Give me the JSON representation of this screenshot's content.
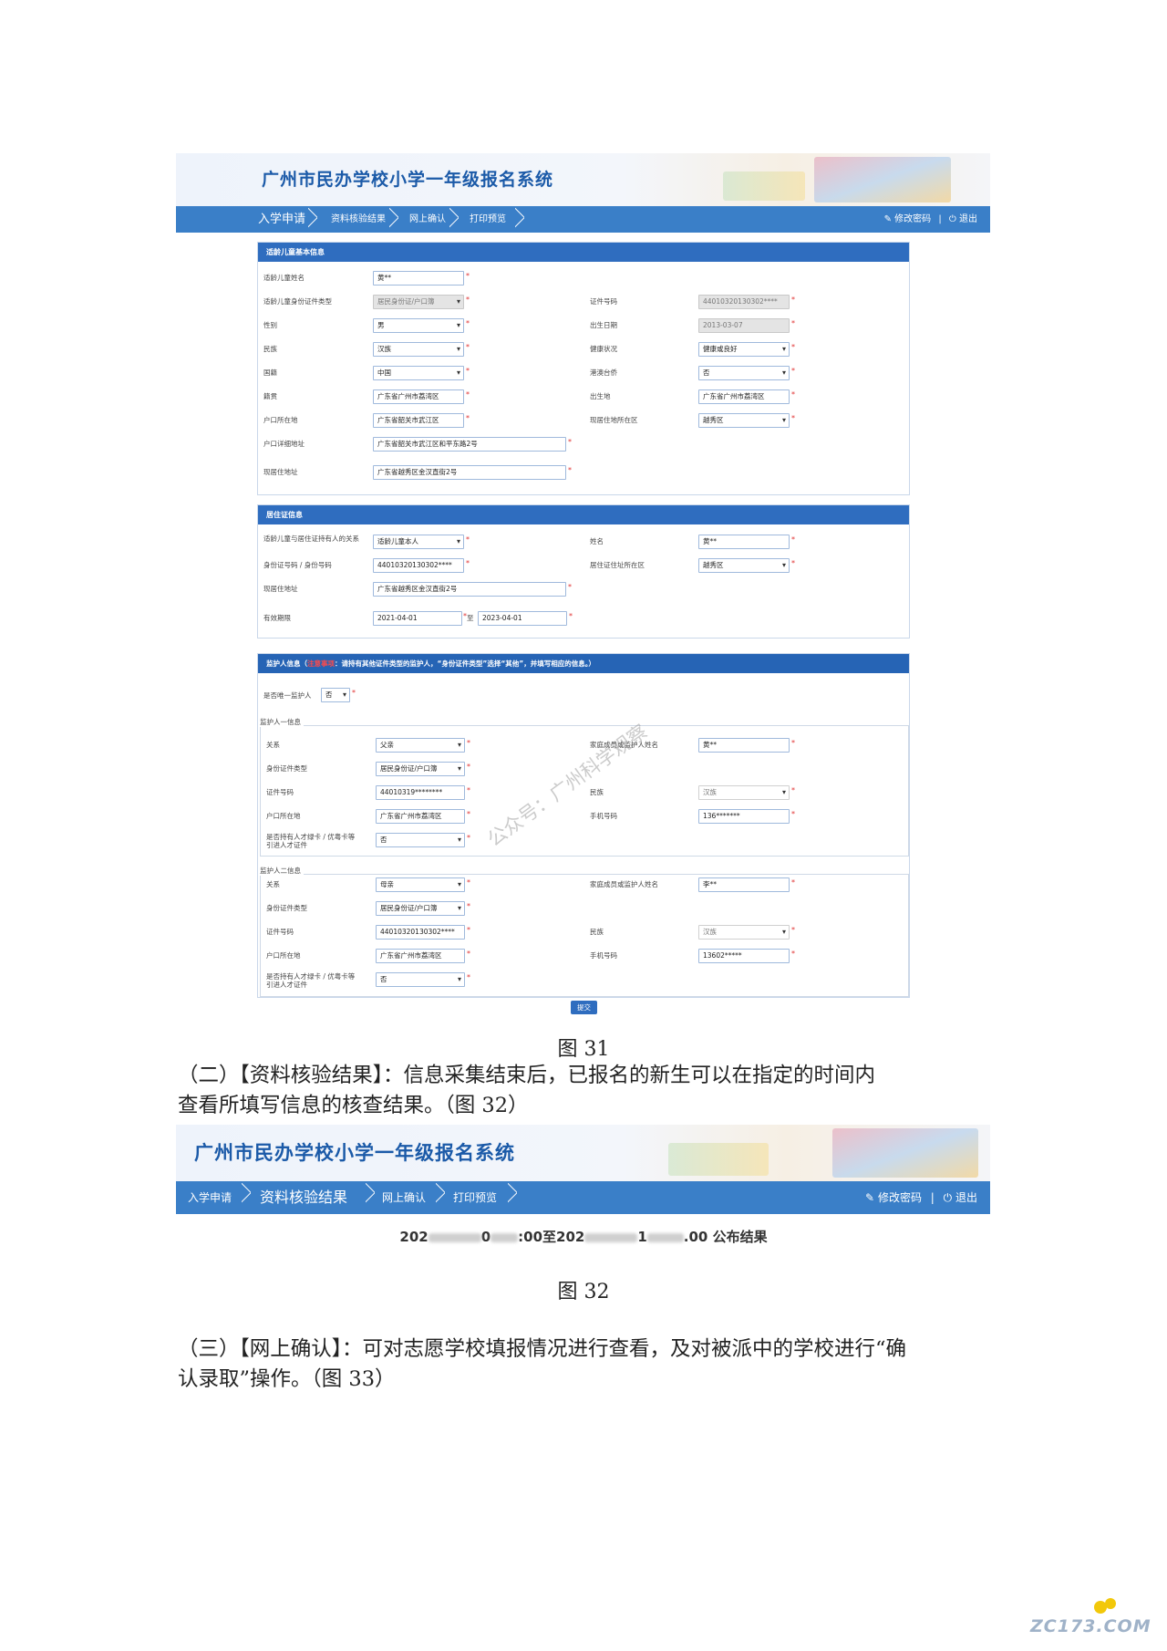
{
  "system_title": "广州市民办学校小学一年级报名系统",
  "nav": {
    "items": [
      "入学申请",
      "资料核验结果",
      "网上确认",
      "打印预览"
    ],
    "change_password": "修改密码",
    "separator": "|",
    "logout": "退出"
  },
  "child_info": {
    "heading": "适龄儿童基本信息",
    "fields": [
      {
        "label": "适龄儿童姓名",
        "value": "黄**"
      },
      {
        "label": "适龄儿童身份证件类型",
        "value": "居民身份证/户口簿"
      },
      {
        "label": "证件号码",
        "value": "44010320130302****"
      },
      {
        "label": "性别",
        "value": "男"
      },
      {
        "label": "出生日期",
        "value": "2013-03-07"
      },
      {
        "label": "民族",
        "value": "汉族"
      },
      {
        "label": "健康状况",
        "value": "健康或良好"
      },
      {
        "label": "国籍",
        "value": "中国"
      },
      {
        "label": "港澳台侨",
        "value": "否"
      },
      {
        "label": "籍贯",
        "value": "广东省广州市荔湾区"
      },
      {
        "label": "出生地",
        "value": "广东省广州市荔湾区"
      },
      {
        "label": "户口所在地",
        "value": "广东省韶关市武江区"
      },
      {
        "label": "现居住地所在区",
        "value": "越秀区"
      },
      {
        "label": "户口详细地址",
        "value": "广东省韶关市武江区和平东路2号"
      },
      {
        "label": "现居住地址",
        "value": "广东省越秀区金汉直街2号"
      }
    ]
  },
  "residence": {
    "heading": "居住证信息",
    "fields": [
      {
        "label": "适龄儿童与居住证持有人的关系",
        "value": "适龄儿童本人"
      },
      {
        "label": "姓名",
        "value": "黄**"
      },
      {
        "label": "身份证号码 / 身份号码",
        "value": "44010320130302****"
      },
      {
        "label": "居住证住址所在区",
        "value": "越秀区"
      },
      {
        "label": "现居住地址",
        "value": "广东省越秀区金汉直街2号"
      },
      {
        "label": "有效期限",
        "value": "2021-04-01"
      },
      {
        "label": "至",
        "value": "2023-04-01"
      }
    ]
  },
  "guardian": {
    "heading_prefix": "监护人信息（",
    "heading_flag": "注意事项",
    "heading_text": "：请持有其他证件类型的监护人，“身份证件类型”选择“其他”，并填写相应的信息。）",
    "only_label": "是否唯一监护人",
    "only_value": "否",
    "g1_title": "监护人一信息",
    "g1": [
      {
        "label": "关系",
        "value": "父亲"
      },
      {
        "label": "家庭成员或监护人姓名",
        "value": "黄**"
      },
      {
        "label": "身份证件类型",
        "value": "居民身份证/户口簿"
      },
      {
        "label": "证件号码",
        "value": "44010319********"
      },
      {
        "label": "民族",
        "value": "汉族"
      },
      {
        "label": "户口所在地",
        "value": "广东省广州市荔湾区"
      },
      {
        "label": "手机号码",
        "value": "136*******"
      },
      {
        "label": "是否持有人才绿卡 / 优粤卡等引进人才证件",
        "value": "否"
      }
    ],
    "g2_title": "监护人二信息",
    "g2": [
      {
        "label": "关系",
        "value": "母亲"
      },
      {
        "label": "家庭成员或监护人姓名",
        "value": "李**"
      },
      {
        "label": "身份证件类型",
        "value": "居民身份证/户口簿"
      },
      {
        "label": "证件号码",
        "value": "44010320130302****"
      },
      {
        "label": "民族",
        "value": "汉族"
      },
      {
        "label": "户口所在地",
        "value": "广东省广州市荔湾区"
      },
      {
        "label": "手机号码",
        "value": "13602*****"
      },
      {
        "label": "是否持有人才绿卡 / 优粤卡等引进人才证件",
        "value": "否"
      }
    ],
    "submit": "提交"
  },
  "watermark": "公众号：广州科学观察",
  "caption31": "图 31",
  "para2_line1": "（二）【资料核验结果】：信息采集结束后，已报名的新生可以在指定的时间内",
  "para2_line2": "查看所填写信息的核查结果。（图 32）",
  "result": {
    "text1": "202",
    "text2": "0",
    "text3": ":00至202",
    "text4": "1",
    "text5": ".00 公布结果"
  },
  "caption32": "图 32",
  "para3_line1": "（三）【网上确认】：可对志愿学校填报情况进行查看，及对被派中的学校进行“确",
  "para3_line2": "认录取”操作。（图 33）",
  "footer_logo": "ZC173.COM"
}
